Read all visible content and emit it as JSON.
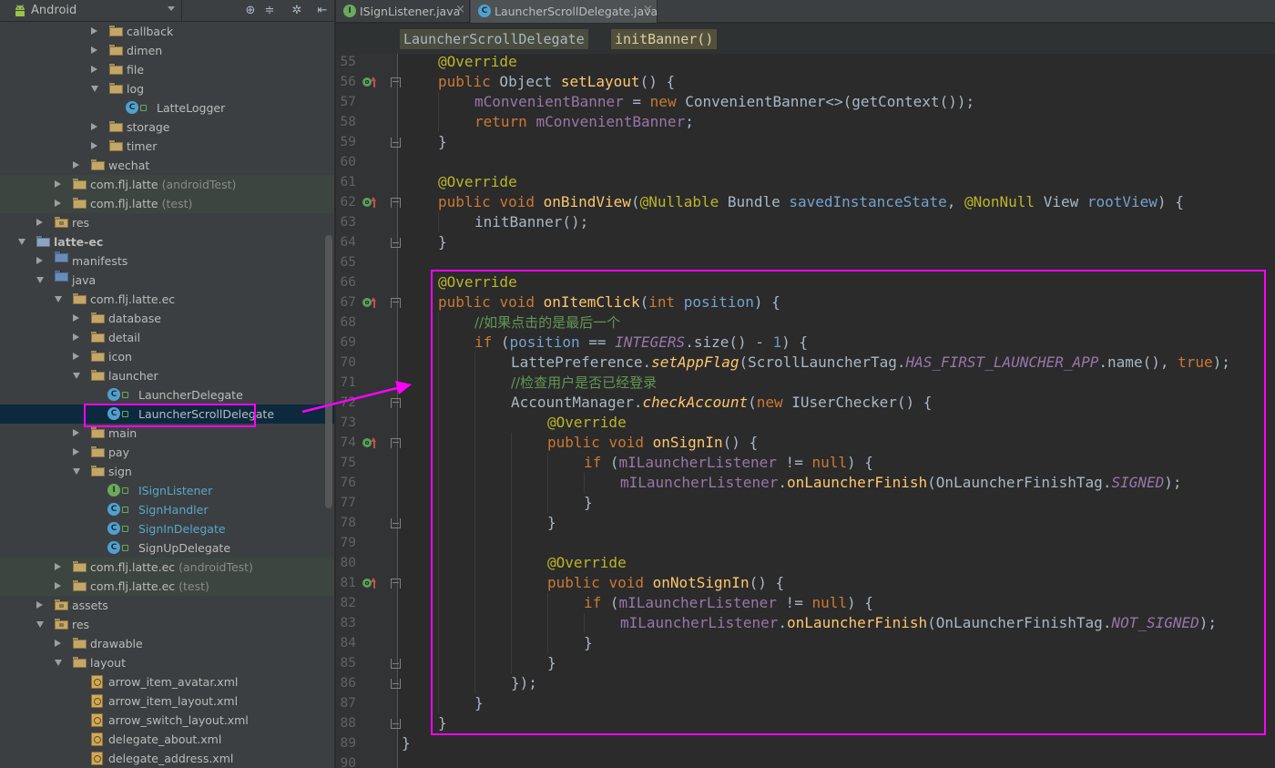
{
  "project_panel": {
    "view": "Android",
    "tree": [
      {
        "label": "callback",
        "suffix": ""
      },
      {
        "label": "dimen",
        "suffix": ""
      },
      {
        "label": "file",
        "suffix": ""
      },
      {
        "label": "log",
        "suffix": ""
      },
      {
        "label": "LatteLogger",
        "suffix": ""
      },
      {
        "label": "storage",
        "suffix": ""
      },
      {
        "label": "timer",
        "suffix": ""
      },
      {
        "label": "wechat",
        "suffix": ""
      },
      {
        "label": "com.flj.latte",
        "suffix": " (androidTest)"
      },
      {
        "label": "com.flj.latte",
        "suffix": " (test)"
      },
      {
        "label": "res",
        "suffix": ""
      },
      {
        "label": "latte-ec",
        "suffix": ""
      },
      {
        "label": "manifests",
        "suffix": ""
      },
      {
        "label": "java",
        "suffix": ""
      },
      {
        "label": "com.flj.latte.ec",
        "suffix": ""
      },
      {
        "label": "database",
        "suffix": ""
      },
      {
        "label": "detail",
        "suffix": ""
      },
      {
        "label": "icon",
        "suffix": ""
      },
      {
        "label": "launcher",
        "suffix": ""
      },
      {
        "label": "LauncherDelegate",
        "suffix": ""
      },
      {
        "label": "LauncherScrollDelegate",
        "suffix": ""
      },
      {
        "label": "main",
        "suffix": ""
      },
      {
        "label": "pay",
        "suffix": ""
      },
      {
        "label": "sign",
        "suffix": ""
      },
      {
        "label": "ISignListener",
        "suffix": ""
      },
      {
        "label": "SignHandler",
        "suffix": ""
      },
      {
        "label": "SignInDelegate",
        "suffix": ""
      },
      {
        "label": "SignUpDelegate",
        "suffix": ""
      },
      {
        "label": "com.flj.latte.ec",
        "suffix": " (androidTest)"
      },
      {
        "label": "com.flj.latte.ec",
        "suffix": " (test)"
      },
      {
        "label": "assets",
        "suffix": ""
      },
      {
        "label": "res",
        "suffix": ""
      },
      {
        "label": "drawable",
        "suffix": ""
      },
      {
        "label": "layout",
        "suffix": ""
      },
      {
        "label": "arrow_item_avatar.xml",
        "suffix": ""
      },
      {
        "label": "arrow_item_layout.xml",
        "suffix": ""
      },
      {
        "label": "arrow_switch_layout.xml",
        "suffix": ""
      },
      {
        "label": "delegate_about.xml",
        "suffix": ""
      },
      {
        "label": "delegate_address.xml",
        "suffix": ""
      }
    ]
  },
  "tabs": [
    {
      "icon": "I",
      "name": "ISignListener.java",
      "close": "×"
    },
    {
      "icon": "C",
      "name": "LauncherScrollDelegate.java",
      "close": "×"
    }
  ],
  "breadcrumb": {
    "class": "LauncherScrollDelegate",
    "method": "initBanner()"
  },
  "line_numbers": [
    "55",
    "56",
    "57",
    "58",
    "59",
    "60",
    "61",
    "62",
    "63",
    "64",
    "65",
    "66",
    "67",
    "68",
    "69",
    "70",
    "71",
    "72",
    "73",
    "74",
    "75",
    "76",
    "77",
    "78",
    "79",
    "80",
    "81",
    "82",
    "83",
    "84",
    "85",
    "86",
    "87",
    "88",
    "89",
    "90"
  ],
  "code": {
    "l55_ann": "@Override",
    "l56_kw": "public",
    "l56_t": " Object ",
    "l56_fn": "setLayout",
    "l56_e": "() {",
    "l57_f": "mConvenientBanner",
    "l57_eq": " = ",
    "l57_kw": "new",
    "l57_e": " ConvenientBanner<>(getContext());",
    "l58_kw": "return",
    "l58_sp": " ",
    "l58_f": "mConvenientBanner",
    "l58_e": ";",
    "l59": "}",
    "l61_ann": "@Override",
    "l62_kw1": "public",
    "l62_sp1": " ",
    "l62_kw2": "void",
    "l62_sp2": " ",
    "l62_fn": "onBindView",
    "l62_p": "(",
    "l62_ann1": "@Nullable",
    "l62_t1": " Bundle ",
    "l62_pr1": "savedInstanceState",
    "l62_c": ", ",
    "l62_ann2": "@NonNull",
    "l62_t2": " View ",
    "l62_pr2": "rootView",
    "l62_e": ") {",
    "l63": "initBanner();",
    "l64": "}",
    "l66_ann": "@Override",
    "l67_kw1": "public",
    "l67_sp1": " ",
    "l67_kw2": "void",
    "l67_sp2": " ",
    "l67_fn": "onItemClick",
    "l67_p": "(",
    "l67_kw3": "int",
    "l67_sp3": " ",
    "l67_pr": "position",
    "l67_e": ") {",
    "l68_cm": "//如果点击的是最后一个",
    "l69_kw": "if",
    "l69_p": " (",
    "l69_pr": "position",
    "l69_eq": " == ",
    "l69_f": "INTEGERS",
    "l69_m": ".size() - ",
    "l69_num": "1",
    "l69_e": ") {",
    "l70_a": "LattePreference.",
    "l70_fn": "setAppFlag",
    "l70_b": "(ScrollLauncherTag.",
    "l70_f": "HAS_FIRST_LAUNCHER_APP",
    "l70_c": ".name(), ",
    "l70_kw": "true",
    "l70_e": ");",
    "l71_cm": "//检查用户是否已经登录",
    "l72_a": "AccountManager.",
    "l72_fn": "checkAccount",
    "l72_p": "(",
    "l72_kw": "new",
    "l72_e": " IUserChecker() {",
    "l73_ann": "@Override",
    "l74_kw1": "public",
    "l74_sp1": " ",
    "l74_kw2": "void",
    "l74_sp2": " ",
    "l74_fn": "onSignIn",
    "l74_e": "() {",
    "l75_kw": "if",
    "l75_p": " (",
    "l75_f": "mILauncherListener",
    "l75_ne": " != ",
    "l75_kw2": "null",
    "l75_e": ") {",
    "l76_f": "mILauncherListener",
    "l76_d": ".",
    "l76_fn": "onLauncherFinish",
    "l76_b": "(OnLauncherFinishTag.",
    "l76_f2": "SIGNED",
    "l76_e": ");",
    "l77": "}",
    "l78": "}",
    "l80_ann": "@Override",
    "l81_kw1": "public",
    "l81_sp1": " ",
    "l81_kw2": "void",
    "l81_sp2": " ",
    "l81_fn": "onNotSignIn",
    "l81_e": "() {",
    "l82_kw": "if",
    "l82_p": " (",
    "l82_f": "mILauncherListener",
    "l82_ne": " != ",
    "l82_kw2": "null",
    "l82_e": ") {",
    "l83_f": "mILauncherListener",
    "l83_d": ".",
    "l83_fn": "onLauncherFinish",
    "l83_b": "(OnLauncherFinishTag.",
    "l83_f2": "NOT_SIGNED",
    "l83_e": ");",
    "l84": "}",
    "l85": "}",
    "l86": "});",
    "l87": "}",
    "l88": "}",
    "l89": "}"
  },
  "colors": {
    "highlight": "#ff00ff",
    "keyword": "#cc7832",
    "annotation": "#bbb529",
    "field": "#9876aa",
    "method": "#ffc66d",
    "comment": "#629755",
    "number": "#6897bb"
  }
}
